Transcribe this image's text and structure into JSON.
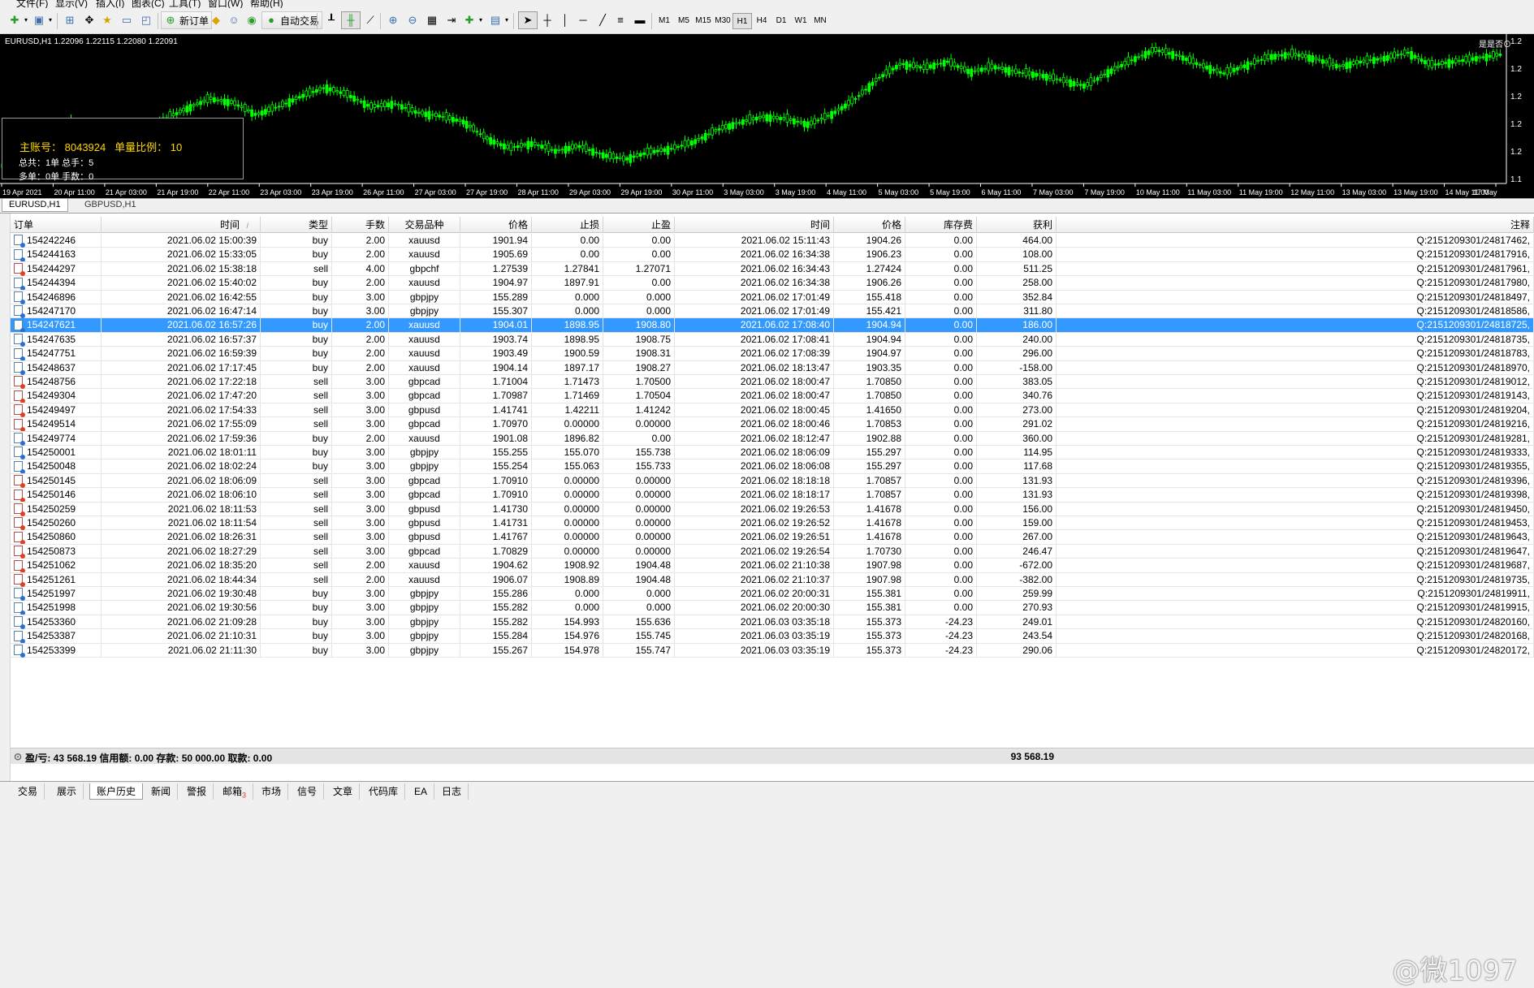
{
  "menu": [
    "文件(F)",
    "显示(V)",
    "插入(I)",
    "图表(C)",
    "工具(T)",
    "窗口(W)",
    "帮助(H)"
  ],
  "toolbar": {
    "new_order": "新订单",
    "auto_trading": "自动交易",
    "timeframes": [
      "M1",
      "M5",
      "M15",
      "M30",
      "H1",
      "H4",
      "D1",
      "W1",
      "MN"
    ],
    "active_timeframe": "H1"
  },
  "chart": {
    "title": "EURUSD,H1  1.22096 1.22115 1.22080 1.22091",
    "corner": "是是否⊙",
    "price_labels": [
      "1.2",
      "1.2",
      "1.2",
      "1.2",
      "1.2",
      "1.1"
    ],
    "time_labels": [
      "19 Apr 2021",
      "20 Apr 11:00",
      "21 Apr 03:00",
      "21 Apr 19:00",
      "22 Apr 11:00",
      "23 Apr 03:00",
      "23 Apr 19:00",
      "26 Apr 11:00",
      "27 Apr 03:00",
      "27 Apr 19:00",
      "28 Apr 11:00",
      "29 Apr 03:00",
      "29 Apr 19:00",
      "30 Apr 11:00",
      "3 May 03:00",
      "3 May 19:00",
      "4 May 11:00",
      "5 May 03:00",
      "5 May 19:00",
      "6 May 11:00",
      "7 May 03:00",
      "7 May 19:00",
      "10 May 11:00",
      "11 May 03:00",
      "11 May 19:00",
      "12 May 11:00",
      "13 May 03:00",
      "13 May 19:00",
      "14 May 11:00",
      "17 May"
    ],
    "close_trend": [
      1.1995,
      1.2005,
      1.2032,
      1.2058,
      1.2041,
      1.2053,
      1.2049,
      1.2062,
      1.2078,
      1.2092,
      1.2086,
      1.2069,
      1.2081,
      1.2096,
      1.2108,
      1.2097,
      1.208,
      1.2085,
      1.2072,
      1.2067,
      1.2059,
      1.2035,
      1.2021,
      1.2028,
      1.2017,
      1.2024,
      1.2012,
      1.2005,
      1.2015,
      1.202,
      1.203,
      1.2047,
      1.2058,
      1.2066,
      1.2063,
      1.2055,
      1.207,
      1.2091,
      1.2121,
      1.2142,
      1.2136,
      1.2145,
      1.213,
      1.2138,
      1.213,
      1.2126,
      1.2118,
      1.211,
      1.213,
      1.2147,
      1.2162,
      1.2154,
      1.214,
      1.2128,
      1.214,
      1.2152,
      1.2156,
      1.2149,
      1.2138,
      1.2145,
      1.215,
      1.2158,
      1.214,
      1.2145,
      1.215,
      1.2155
    ],
    "overlay": {
      "account_label": "主账号：",
      "account_number": "8043924",
      "ratio_label": "单量比例：",
      "ratio_value": "10",
      "total_line": "总共：1单  总手：5",
      "long_line": "多单：0单  手数：0"
    },
    "colors": {
      "bg": "#000000",
      "candle": "#00ff00",
      "overlay_text": "#ffd700"
    }
  },
  "chart_tabs": [
    "EURUSD,H1",
    "GBPUSD,H1"
  ],
  "active_chart_tab": "EURUSD,H1",
  "columns": [
    "订单",
    "时间",
    "类型",
    "手数",
    "交易品种",
    "价格",
    "止损",
    "止盈",
    "时间",
    "价格",
    "库存费",
    "获利",
    "注释"
  ],
  "sort_indicator": "/",
  "selected_order": "154247621",
  "rows": [
    [
      "154242246",
      "2021.06.02 15:00:39",
      "buy",
      "2.00",
      "xauusd",
      "1901.94",
      "0.00",
      "0.00",
      "2021.06.02 15:11:43",
      "1904.26",
      "0.00",
      "464.00",
      "Q:2151209301/24817462,"
    ],
    [
      "154244163",
      "2021.06.02 15:33:05",
      "buy",
      "2.00",
      "xauusd",
      "1905.69",
      "0.00",
      "0.00",
      "2021.06.02 16:34:38",
      "1906.23",
      "0.00",
      "108.00",
      "Q:2151209301/24817916,"
    ],
    [
      "154244297",
      "2021.06.02 15:38:18",
      "sell",
      "4.00",
      "gbpchf",
      "1.27539",
      "1.27841",
      "1.27071",
      "2021.06.02 16:34:43",
      "1.27424",
      "0.00",
      "511.25",
      "Q:2151209301/24817961,"
    ],
    [
      "154244394",
      "2021.06.02 15:40:02",
      "buy",
      "2.00",
      "xauusd",
      "1904.97",
      "1897.91",
      "0.00",
      "2021.06.02 16:34:38",
      "1906.26",
      "0.00",
      "258.00",
      "Q:2151209301/24817980,"
    ],
    [
      "154246896",
      "2021.06.02 16:42:55",
      "buy",
      "3.00",
      "gbpjpy",
      "155.289",
      "0.000",
      "0.000",
      "2021.06.02 17:01:49",
      "155.418",
      "0.00",
      "352.84",
      "Q:2151209301/24818497,"
    ],
    [
      "154247170",
      "2021.06.02 16:47:14",
      "buy",
      "3.00",
      "gbpjpy",
      "155.307",
      "0.000",
      "0.000",
      "2021.06.02 17:01:49",
      "155.421",
      "0.00",
      "311.80",
      "Q:2151209301/24818586,"
    ],
    [
      "154247621",
      "2021.06.02 16:57:26",
      "buy",
      "2.00",
      "xauusd",
      "1904.01",
      "1898.95",
      "1908.80",
      "2021.06.02 17:08:40",
      "1904.94",
      "0.00",
      "186.00",
      "Q:2151209301/24818725,"
    ],
    [
      "154247635",
      "2021.06.02 16:57:37",
      "buy",
      "2.00",
      "xauusd",
      "1903.74",
      "1898.95",
      "1908.75",
      "2021.06.02 17:08:41",
      "1904.94",
      "0.00",
      "240.00",
      "Q:2151209301/24818735,"
    ],
    [
      "154247751",
      "2021.06.02 16:59:39",
      "buy",
      "2.00",
      "xauusd",
      "1903.49",
      "1900.59",
      "1908.31",
      "2021.06.02 17:08:39",
      "1904.97",
      "0.00",
      "296.00",
      "Q:2151209301/24818783,"
    ],
    [
      "154248637",
      "2021.06.02 17:17:45",
      "buy",
      "2.00",
      "xauusd",
      "1904.14",
      "1897.17",
      "1908.27",
      "2021.06.02 18:13:47",
      "1903.35",
      "0.00",
      "-158.00",
      "Q:2151209301/24818970,"
    ],
    [
      "154248756",
      "2021.06.02 17:22:18",
      "sell",
      "3.00",
      "gbpcad",
      "1.71004",
      "1.71473",
      "1.70500",
      "2021.06.02 18:00:47",
      "1.70850",
      "0.00",
      "383.05",
      "Q:2151209301/24819012,"
    ],
    [
      "154249304",
      "2021.06.02 17:47:20",
      "sell",
      "3.00",
      "gbpcad",
      "1.70987",
      "1.71469",
      "1.70504",
      "2021.06.02 18:00:47",
      "1.70850",
      "0.00",
      "340.76",
      "Q:2151209301/24819143,"
    ],
    [
      "154249497",
      "2021.06.02 17:54:33",
      "sell",
      "3.00",
      "gbpusd",
      "1.41741",
      "1.42211",
      "1.41242",
      "2021.06.02 18:00:45",
      "1.41650",
      "0.00",
      "273.00",
      "Q:2151209301/24819204,"
    ],
    [
      "154249514",
      "2021.06.02 17:55:09",
      "sell",
      "3.00",
      "gbpcad",
      "1.70970",
      "0.00000",
      "0.00000",
      "2021.06.02 18:00:46",
      "1.70853",
      "0.00",
      "291.02",
      "Q:2151209301/24819216,"
    ],
    [
      "154249774",
      "2021.06.02 17:59:36",
      "buy",
      "2.00",
      "xauusd",
      "1901.08",
      "1896.82",
      "0.00",
      "2021.06.02 18:12:47",
      "1902.88",
      "0.00",
      "360.00",
      "Q:2151209301/24819281,"
    ],
    [
      "154250001",
      "2021.06.02 18:01:11",
      "buy",
      "3.00",
      "gbpjpy",
      "155.255",
      "155.070",
      "155.738",
      "2021.06.02 18:06:09",
      "155.297",
      "0.00",
      "114.95",
      "Q:2151209301/24819333,"
    ],
    [
      "154250048",
      "2021.06.02 18:02:24",
      "buy",
      "3.00",
      "gbpjpy",
      "155.254",
      "155.063",
      "155.733",
      "2021.06.02 18:06:08",
      "155.297",
      "0.00",
      "117.68",
      "Q:2151209301/24819355,"
    ],
    [
      "154250145",
      "2021.06.02 18:06:09",
      "sell",
      "3.00",
      "gbpcad",
      "1.70910",
      "0.00000",
      "0.00000",
      "2021.06.02 18:18:18",
      "1.70857",
      "0.00",
      "131.93",
      "Q:2151209301/24819396,"
    ],
    [
      "154250146",
      "2021.06.02 18:06:10",
      "sell",
      "3.00",
      "gbpcad",
      "1.70910",
      "0.00000",
      "0.00000",
      "2021.06.02 18:18:17",
      "1.70857",
      "0.00",
      "131.93",
      "Q:2151209301/24819398,"
    ],
    [
      "154250259",
      "2021.06.02 18:11:53",
      "sell",
      "3.00",
      "gbpusd",
      "1.41730",
      "0.00000",
      "0.00000",
      "2021.06.02 19:26:53",
      "1.41678",
      "0.00",
      "156.00",
      "Q:2151209301/24819450,"
    ],
    [
      "154250260",
      "2021.06.02 18:11:54",
      "sell",
      "3.00",
      "gbpusd",
      "1.41731",
      "0.00000",
      "0.00000",
      "2021.06.02 19:26:52",
      "1.41678",
      "0.00",
      "159.00",
      "Q:2151209301/24819453,"
    ],
    [
      "154250860",
      "2021.06.02 18:26:31",
      "sell",
      "3.00",
      "gbpusd",
      "1.41767",
      "0.00000",
      "0.00000",
      "2021.06.02 19:26:51",
      "1.41678",
      "0.00",
      "267.00",
      "Q:2151209301/24819643,"
    ],
    [
      "154250873",
      "2021.06.02 18:27:29",
      "sell",
      "3.00",
      "gbpcad",
      "1.70829",
      "0.00000",
      "0.00000",
      "2021.06.02 19:26:54",
      "1.70730",
      "0.00",
      "246.47",
      "Q:2151209301/24819647,"
    ],
    [
      "154251062",
      "2021.06.02 18:35:20",
      "sell",
      "2.00",
      "xauusd",
      "1904.62",
      "1908.92",
      "1904.48",
      "2021.06.02 21:10:38",
      "1907.98",
      "0.00",
      "-672.00",
      "Q:2151209301/24819687,"
    ],
    [
      "154251261",
      "2021.06.02 18:44:34",
      "sell",
      "2.00",
      "xauusd",
      "1906.07",
      "1908.89",
      "1904.48",
      "2021.06.02 21:10:37",
      "1907.98",
      "0.00",
      "-382.00",
      "Q:2151209301/24819735,"
    ],
    [
      "154251997",
      "2021.06.02 19:30:48",
      "buy",
      "3.00",
      "gbpjpy",
      "155.286",
      "0.000",
      "0.000",
      "2021.06.02 20:00:31",
      "155.381",
      "0.00",
      "259.99",
      "Q:2151209301/24819911,"
    ],
    [
      "154251998",
      "2021.06.02 19:30:56",
      "buy",
      "3.00",
      "gbpjpy",
      "155.282",
      "0.000",
      "0.000",
      "2021.06.02 20:00:30",
      "155.381",
      "0.00",
      "270.93",
      "Q:2151209301/24819915,"
    ],
    [
      "154253360",
      "2021.06.02 21:09:28",
      "buy",
      "3.00",
      "gbpjpy",
      "155.282",
      "154.993",
      "155.636",
      "2021.06.03 03:35:18",
      "155.373",
      "-24.23",
      "249.01",
      "Q:2151209301/24820160,"
    ],
    [
      "154253387",
      "2021.06.02 21:10:31",
      "buy",
      "3.00",
      "gbpjpy",
      "155.284",
      "154.976",
      "155.745",
      "2021.06.03 03:35:19",
      "155.373",
      "-24.23",
      "243.54",
      "Q:2151209301/24820168,"
    ],
    [
      "154253399",
      "2021.06.02 21:11:30",
      "buy",
      "3.00",
      "gbpjpy",
      "155.267",
      "154.978",
      "155.747",
      "2021.06.03 03:35:19",
      "155.373",
      "-24.23",
      "290.06",
      "Q:2151209301/24820172,"
    ]
  ],
  "summary": {
    "line": "盈/亏: 43 568.19  信用额: 0.00  存款: 50 000.00  取款: 0.00",
    "total_profit": "93 568.19"
  },
  "bottom_tabs": [
    {
      "label": "交易"
    },
    {
      "label": "展示"
    },
    {
      "label": "账户历史"
    },
    {
      "label": "新闻"
    },
    {
      "label": "警报"
    },
    {
      "label": "邮箱",
      "badge": "3"
    },
    {
      "label": "市场"
    },
    {
      "label": "信号"
    },
    {
      "label": "文章"
    },
    {
      "label": "代码库"
    },
    {
      "label": "EA"
    },
    {
      "label": "日志"
    }
  ],
  "active_bottom_tab": "账户历史",
  "watermark": "@微1097"
}
